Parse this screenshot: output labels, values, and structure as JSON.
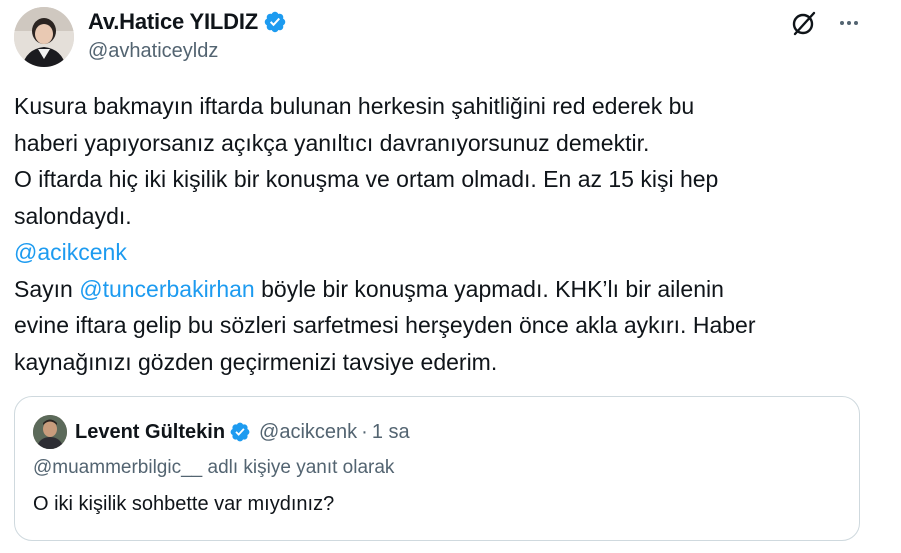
{
  "author": {
    "name": "Av.Hatice YILDIZ",
    "handle": "@avhaticeyldz",
    "verified": true
  },
  "actions": {
    "grok_icon": "grok-icon",
    "more_icon": "more-icon"
  },
  "tweet": {
    "line1": "Kusura bakmayın iftarda bulunan herkesin şahitliğini red ederek bu",
    "line2": "haberi yapıyorsanız açıkça yanıltıcı davranıyorsunuz demektir.",
    "line3": "O iftarda hiç iki kişilik bir konuşma ve ortam olmadı. En az 15 kişi hep",
    "line4": "salondaydı.",
    "mention1": "@acikcenk",
    "line6_prefix": "Sayın ",
    "mention2": "@tuncerbakirhan",
    "line6_suffix": " böyle bir konuşma yapmadı. KHK’lı bir ailenin",
    "line7": "evine iftara gelip bu sözleri sarfetmesi herşeyden önce akla aykırı. Haber",
    "line8": "kaynağınızı gözden geçirmenizi tavsiye ederim."
  },
  "quote": {
    "name": "Levent Gültekin",
    "handle": "@acikcenk",
    "separator": "·",
    "time": "1 sa",
    "reply_context": "@muammerbilgic__ adlı kişiye yanıt olarak",
    "text": "O iki kişilik sohbette var mıydınız?"
  },
  "colors": {
    "text": "#0f1419",
    "secondary": "#536471",
    "accent": "#1d9bf0",
    "border": "#cfd9de"
  }
}
